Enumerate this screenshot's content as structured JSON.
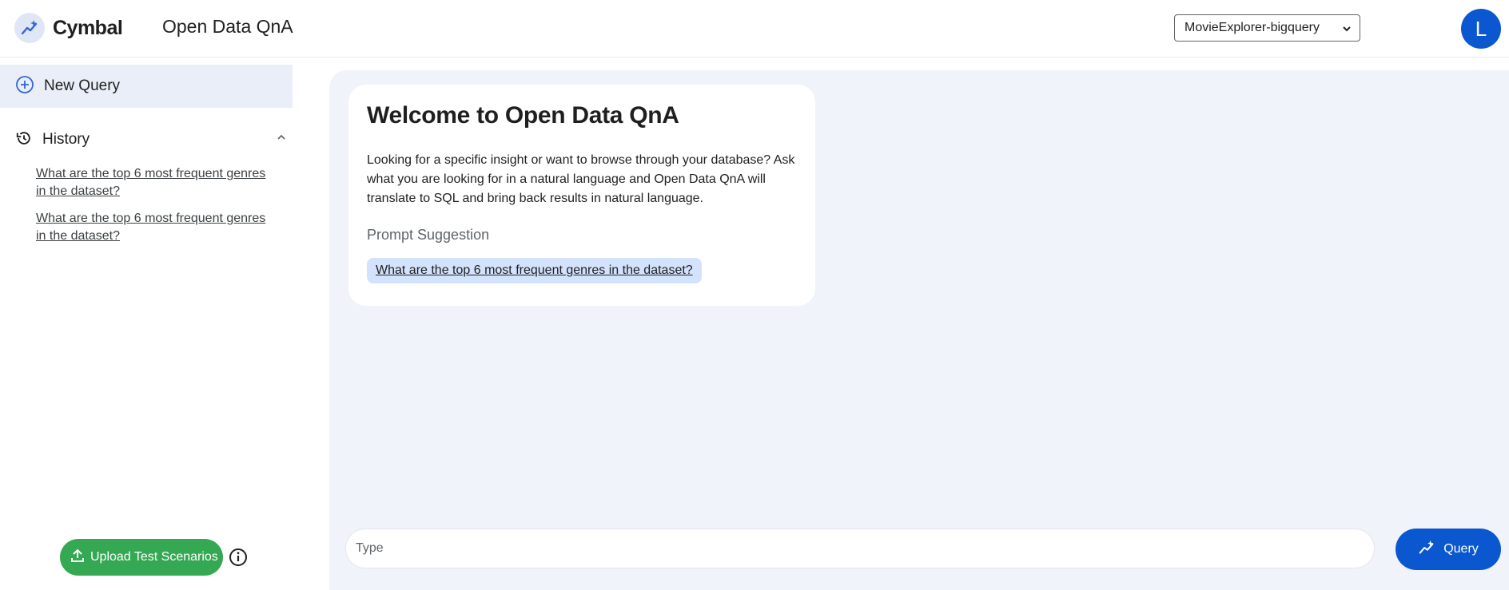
{
  "header": {
    "brand": "Cymbal",
    "app_title": "Open Data QnA",
    "dataset_selected": "MovieExplorer-bigquery",
    "avatar_initial": "L"
  },
  "sidebar": {
    "new_query_label": "New Query",
    "history_label": "History",
    "history_items": [
      "What are the top 6 most frequent genres in the dataset?",
      "What are the top 6 most frequent genres in the dataset?"
    ],
    "upload_label": "Upload Test Scenarios"
  },
  "main": {
    "welcome_title": "Welcome to Open Data QnA",
    "welcome_body": "Looking for a specific insight or want to browse through your database? Ask what you are looking for in a natural language and Open Data QnA will translate to SQL and bring back results in natural language.",
    "prompt_label": "Prompt Suggestion",
    "suggestion": "What are the top 6 most frequent genres in the dataset?",
    "input_placeholder": "Type",
    "query_label": "Query"
  },
  "colors": {
    "accent": "#0b57d0",
    "upload_green": "#34a853",
    "main_bg": "#f0f3fa",
    "selected_nav": "#e9eef8",
    "suggestion_chip": "#d3e3fd"
  }
}
